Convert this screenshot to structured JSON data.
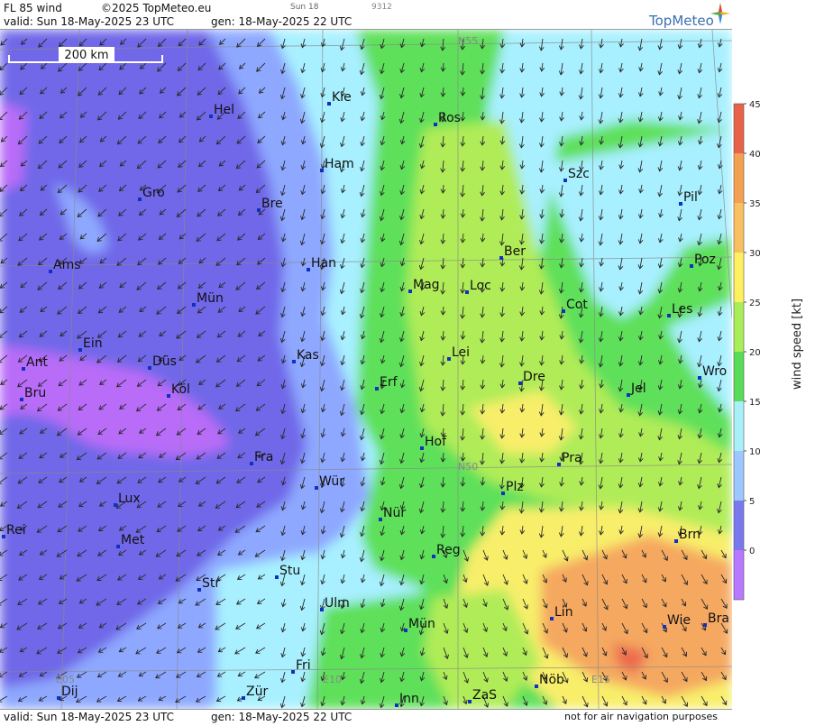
{
  "header": {
    "product": "FL 85 wind",
    "copyright": "©2025 TopMeteo.eu",
    "day_small": "Sun 18",
    "code_small": "9312",
    "valid": "valid:  Sun  18-May-2025  23 UTC",
    "gen": "gen: 18-May-2025 22 UTC",
    "logo_text": "TopMeteo"
  },
  "footer": {
    "valid": "valid:  Sun  18-May-2025  23 UTC",
    "gen": "gen: 18-May-2025 22 UTC",
    "disclaimer": "not for air navigation purposes"
  },
  "map": {
    "scale_label": "200 km",
    "grid_labels": [
      "N55",
      "N50",
      "E05",
      "E10",
      "E15"
    ],
    "wind_direction": "north to north-east flow",
    "cities": [
      "Kie",
      "Hel",
      "Ros",
      "Ham",
      "Szc",
      "Gro",
      "Bre",
      "Pil",
      "Ams",
      "Han",
      "Ber",
      "Poz",
      "Mag",
      "Loc",
      "Mün",
      "Cot",
      "Les",
      "Ein",
      "Kas",
      "Lei",
      "Ant",
      "Düs",
      "Wro",
      "Bru",
      "Köl",
      "Erf",
      "Dre",
      "Jel",
      "Hof",
      "Fra",
      "Pra",
      "Wür",
      "Lux",
      "Plz",
      "Nür",
      "Rei",
      "Met",
      "Reg",
      "Brn",
      "Stu",
      "Str",
      "Lin",
      "Ulm",
      "Wie",
      "Bra",
      "Mün",
      "Fri",
      "Zür",
      "Nöb",
      "Dij",
      "Inn",
      "ZaS"
    ]
  },
  "legend": {
    "title": "wind speed  [kt]",
    "ticks": [
      "45",
      "40",
      "35",
      "30",
      "25",
      "20",
      "15",
      "10",
      "5",
      "0"
    ],
    "colors": [
      "#e8624a",
      "#f4a052",
      "#f8c060",
      "#fff060",
      "#a8ee58",
      "#58dd58",
      "#a8f0f8",
      "#9cc8ff",
      "#7a78ee",
      "#b878ff"
    ]
  },
  "colors": {
    "purple_dark": "#7068e8",
    "purple_light": "#b86cf8",
    "blue": "#8ea8ff",
    "cyan": "#a8f0ff",
    "green": "#5ee05a",
    "lime": "#b0ec58",
    "yellow": "#f8ee6a",
    "orange": "#f5a860",
    "red": "#ec6a50"
  }
}
